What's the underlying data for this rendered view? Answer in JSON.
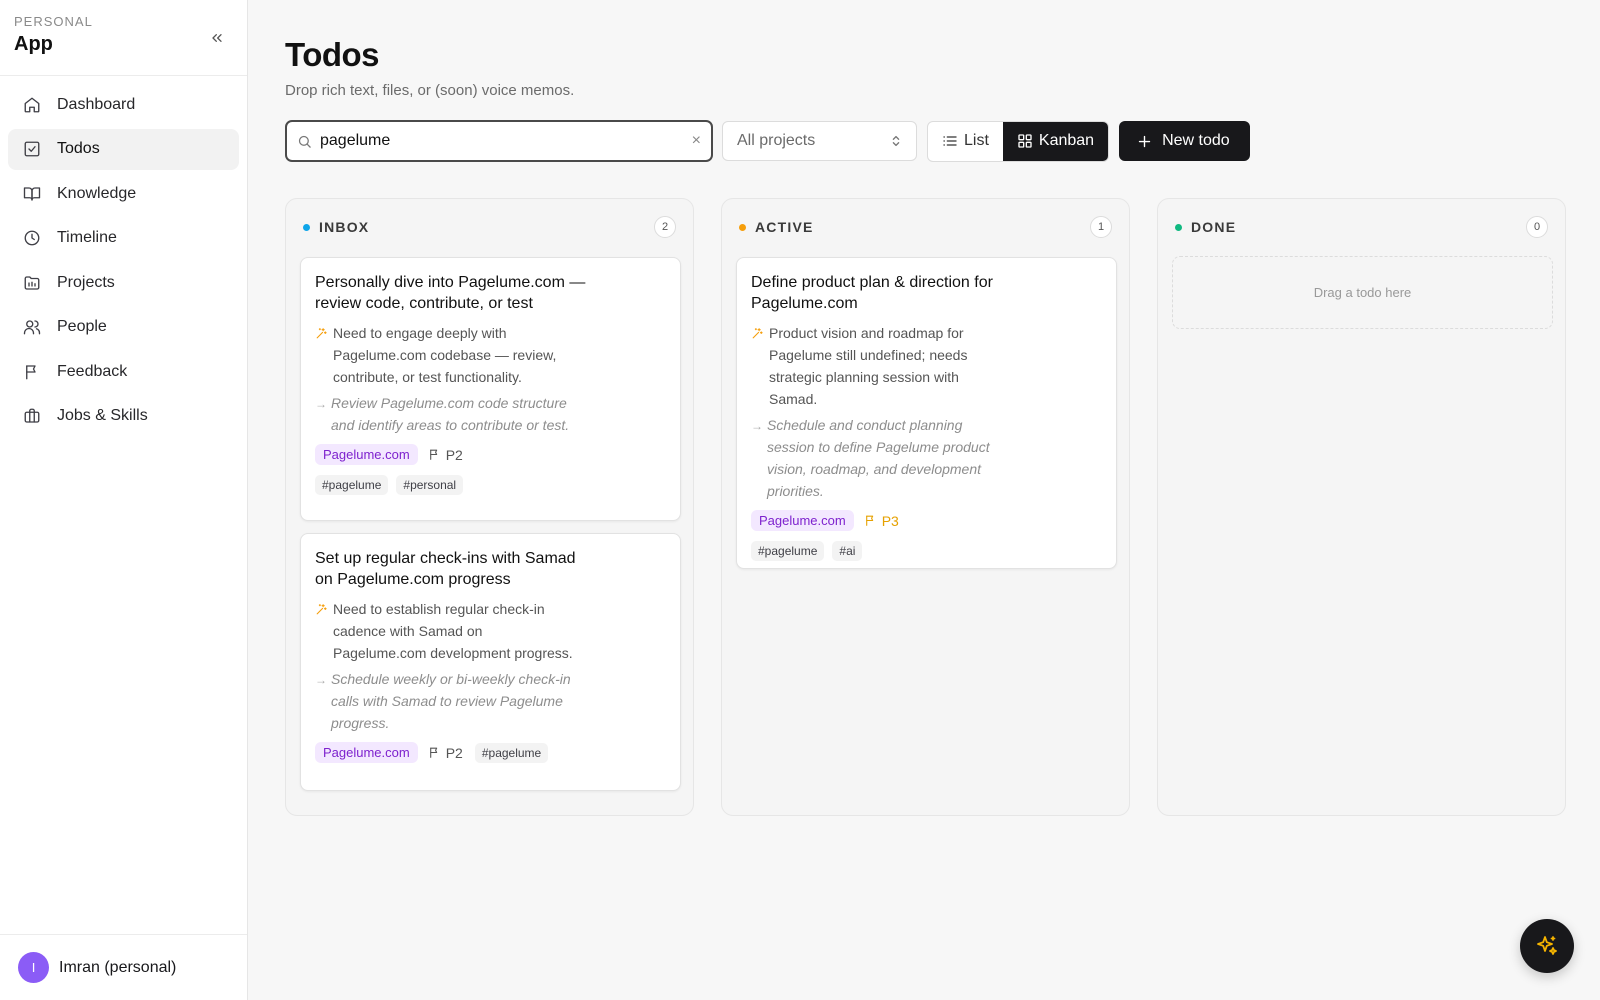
{
  "sidebar": {
    "workspace_kicker": "PERSONAL",
    "workspace_title": "App",
    "nav": [
      {
        "label": "Dashboard",
        "icon": "home-icon"
      },
      {
        "label": "Todos",
        "icon": "checkbox-icon",
        "active": true
      },
      {
        "label": "Knowledge",
        "icon": "book-icon"
      },
      {
        "label": "Timeline",
        "icon": "clock-icon"
      },
      {
        "label": "Projects",
        "icon": "folder-icon"
      },
      {
        "label": "People",
        "icon": "users-icon"
      },
      {
        "label": "Feedback",
        "icon": "flag-icon"
      },
      {
        "label": "Jobs & Skills",
        "icon": "briefcase-icon"
      }
    ],
    "user": {
      "initial": "I",
      "name": "Imran (personal)",
      "avatar_color": "#8b5cf6"
    }
  },
  "page": {
    "title": "Todos",
    "subtitle": "Drop rich text, files, or (soon) voice memos."
  },
  "toolbar": {
    "search_value": "pagelume",
    "project_filter": "All projects",
    "view_list": "List",
    "view_kanban": "Kanban",
    "new_todo": "New todo"
  },
  "columns": [
    {
      "title": "INBOX",
      "count": "2",
      "color": "#0ea5e9",
      "cards": [
        {
          "title": "Personally dive into Pagelume.com — review code, contribute, or test",
          "reason": "Need to engage deeply with Pagelume.com codebase — review, contribute, or test functionality.",
          "next": "Review Pagelume.com code structure and identify areas to contribute or test.",
          "project": "Pagelume.com",
          "priority": "P2",
          "tags": [
            "#pagelume",
            "#personal"
          ]
        },
        {
          "title": "Set up regular check-ins with Samad on Pagelume.com progress",
          "reason": "Need to establish regular check-in cadence with Samad on Pagelume.com development progress.",
          "next": "Schedule weekly or bi-weekly check-in calls with Samad to review Pagelume progress.",
          "project": "Pagelume.com",
          "priority": "P2",
          "tags": [
            "#pagelume"
          ]
        }
      ]
    },
    {
      "title": "ACTIVE",
      "count": "1",
      "color": "#f59e0b",
      "cards": [
        {
          "title": "Define product plan & direction for Pagelume.com",
          "reason": "Product vision and roadmap for Pagelume still undefined; needs strategic planning session with Samad.",
          "next": "Schedule and conduct planning session to define Pagelume product vision, roadmap, and development priorities.",
          "project": "Pagelume.com",
          "priority": "P3",
          "tags": [
            "#pagelume",
            "#ai"
          ]
        }
      ]
    },
    {
      "title": "DONE",
      "count": "0",
      "color": "#10b981",
      "empty_text": "Drag a todo here"
    }
  ]
}
